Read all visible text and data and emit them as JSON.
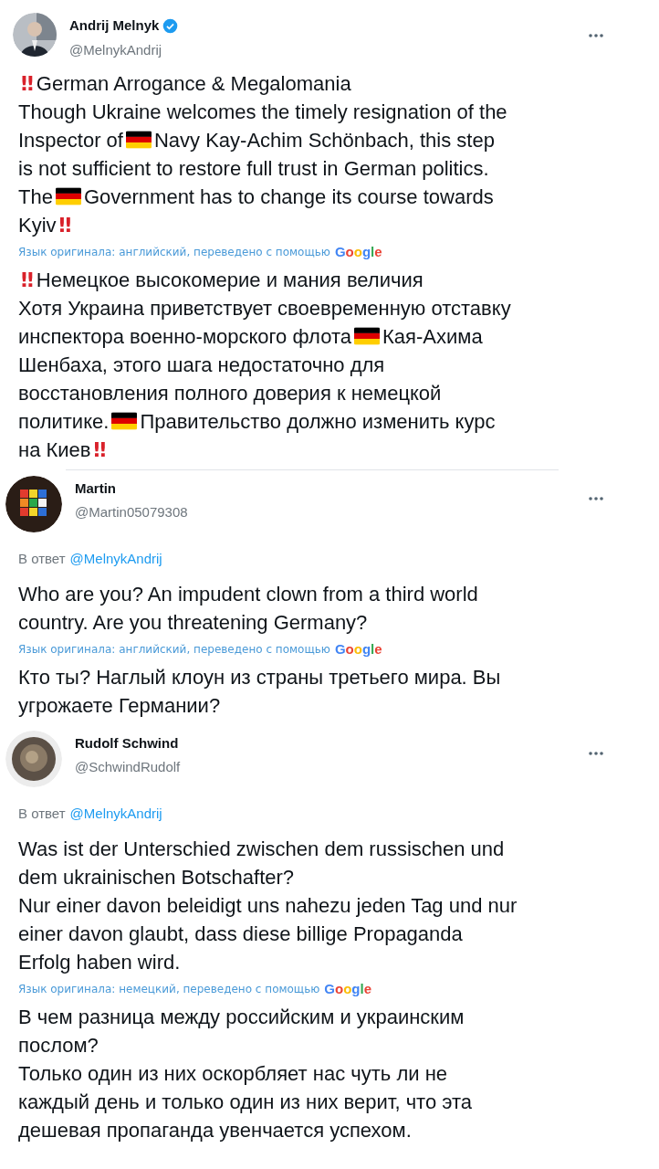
{
  "tweets": [
    {
      "avatar": {
        "kind": "person"
      },
      "author": "Andrij Melnyk",
      "verified": true,
      "handle": "@MelnykAndrij",
      "divider_above": false,
      "text": [
        [
          {
            "kind": "mark",
            "text": "‼"
          },
          {
            "kind": "text",
            "text": "German Arrogance & Megalomania"
          }
        ],
        [
          {
            "kind": "text",
            "text": "Though Ukraine welcomes the timely resignation of the"
          }
        ],
        [
          {
            "kind": "text",
            "text": "Inspector of"
          },
          {
            "kind": "flag"
          },
          {
            "kind": "text",
            "text": "Navy Kay-Achim Schönbach, this step"
          }
        ],
        [
          {
            "kind": "text",
            "text": "is not sufficient to restore full trust in German politics."
          }
        ],
        [
          {
            "kind": "text",
            "text": "The"
          },
          {
            "kind": "flag"
          },
          {
            "kind": "text",
            "text": "Government has to change its course towards"
          }
        ],
        [
          {
            "kind": "text",
            "text": "Kyiv"
          },
          {
            "kind": "mark",
            "text": "‼"
          }
        ]
      ],
      "translation_note": "Язык оригинала: английский, переведено с помощью",
      "translator": "Google",
      "translation": [
        [
          {
            "kind": "mark",
            "text": "‼"
          },
          {
            "kind": "text",
            "text": "Немецкое высокомерие и мания величия"
          }
        ],
        [
          {
            "kind": "text",
            "text": "Хотя Украина приветствует своевременную отставку"
          }
        ],
        [
          {
            "kind": "text",
            "text": "инспектора военно-морского флота"
          },
          {
            "kind": "flag"
          },
          {
            "kind": "text",
            "text": "Кая-Ахима"
          }
        ],
        [
          {
            "kind": "text",
            "text": "Шенбаха, этого шага недостаточно для"
          }
        ],
        [
          {
            "kind": "text",
            "text": "восстановления полного доверия к немецкой"
          }
        ],
        [
          {
            "kind": "text",
            "text": "политике."
          },
          {
            "kind": "flag"
          },
          {
            "kind": "text",
            "text": "Правительство должно изменить курс"
          }
        ],
        [
          {
            "kind": "text",
            "text": "на Киев"
          },
          {
            "kind": "mark",
            "text": "‼"
          }
        ]
      ]
    },
    {
      "avatar": {
        "kind": "cube"
      },
      "author": "Martin",
      "verified": false,
      "handle": "@Martin05079308",
      "divider_above": true,
      "reply_label": "В ответ",
      "reply_handle": "@MelnykAndrij",
      "text": [
        [
          {
            "kind": "text",
            "text": "Who are you? An impudent clown from a third world"
          }
        ],
        [
          {
            "kind": "text",
            "text": "country. Are you threatening Germany?"
          }
        ]
      ],
      "translation_note": "Язык оригинала: английский, переведено с помощью",
      "translator": "Google",
      "translation": [
        [
          {
            "kind": "text",
            "text": "Кто ты? Наглый клоун из страны третьего мира. Вы"
          }
        ],
        [
          {
            "kind": "text",
            "text": "угрожаете Германии?"
          }
        ]
      ]
    },
    {
      "avatar": {
        "kind": "coin"
      },
      "author": "Rudolf Schwind",
      "verified": false,
      "handle": "@SchwindRudolf",
      "divider_above": false,
      "reply_label": "В ответ",
      "reply_handle": "@MelnykAndrij",
      "text": [
        [
          {
            "kind": "text",
            "text": "Was ist der Unterschied zwischen dem russischen und"
          }
        ],
        [
          {
            "kind": "text",
            "text": "dem ukrainischen Botschafter?"
          }
        ],
        [
          {
            "kind": "text",
            "text": "Nur einer davon beleidigt uns nahezu jeden Tag und nur"
          }
        ],
        [
          {
            "kind": "text",
            "text": "einer davon glaubt, dass diese billige Propaganda"
          }
        ],
        [
          {
            "kind": "text",
            "text": "Erfolg haben wird."
          }
        ]
      ],
      "translation_note": "Язык оригинала: немецкий, переведено с помощью",
      "translator": "Google",
      "translation": [
        [
          {
            "kind": "text",
            "text": "В чем разница между российским и украинским"
          }
        ],
        [
          {
            "kind": "text",
            "text": "послом?"
          }
        ],
        [
          {
            "kind": "text",
            "text": "Только один из них оскорбляет нас чуть ли не"
          }
        ],
        [
          {
            "kind": "text",
            "text": "каждый день и только один из них верит, что эта"
          }
        ],
        [
          {
            "kind": "text",
            "text": "дешевая пропаганда увенчается успехом."
          }
        ]
      ]
    }
  ]
}
